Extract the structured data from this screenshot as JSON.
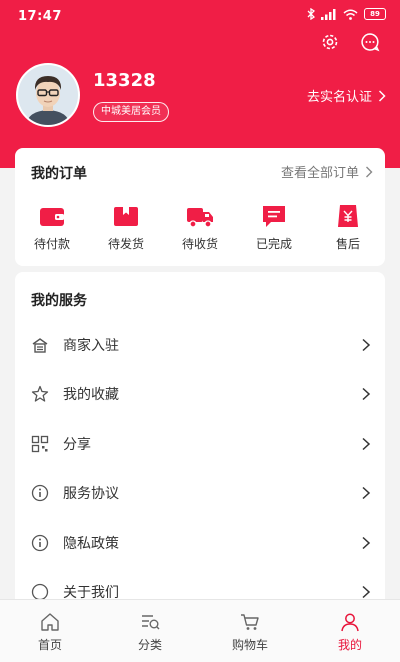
{
  "status_bar": {
    "time": "17:47",
    "battery": "89"
  },
  "profile": {
    "username": "13328",
    "member_tag": "中城美居会员",
    "verify_label": "去实名认证"
  },
  "orders": {
    "title": "我的订单",
    "view_all": "查看全部订单",
    "items": [
      {
        "label": "待付款",
        "icon": "wallet-icon"
      },
      {
        "label": "待发货",
        "icon": "package-icon"
      },
      {
        "label": "待收货",
        "icon": "truck-icon"
      },
      {
        "label": "已完成",
        "icon": "message-icon"
      },
      {
        "label": "售后",
        "icon": "refund-icon"
      }
    ]
  },
  "services": {
    "title": "我的服务",
    "items": [
      {
        "label": "商家入驻",
        "icon": "store-icon"
      },
      {
        "label": "我的收藏",
        "icon": "star-icon"
      },
      {
        "label": "分享",
        "icon": "qr-icon"
      },
      {
        "label": "服务协议",
        "icon": "info-icon"
      },
      {
        "label": "隐私政策",
        "icon": "info-icon"
      },
      {
        "label": "关于我们",
        "icon": "about-icon"
      }
    ]
  },
  "tabbar": {
    "items": [
      {
        "label": "首页",
        "icon": "home-icon"
      },
      {
        "label": "分类",
        "icon": "category-icon"
      },
      {
        "label": "购物车",
        "icon": "cart-icon"
      },
      {
        "label": "我的",
        "icon": "user-icon",
        "active": true
      }
    ]
  },
  "colors": {
    "brand": "#f01e46",
    "active_tab": "#e8143a"
  }
}
